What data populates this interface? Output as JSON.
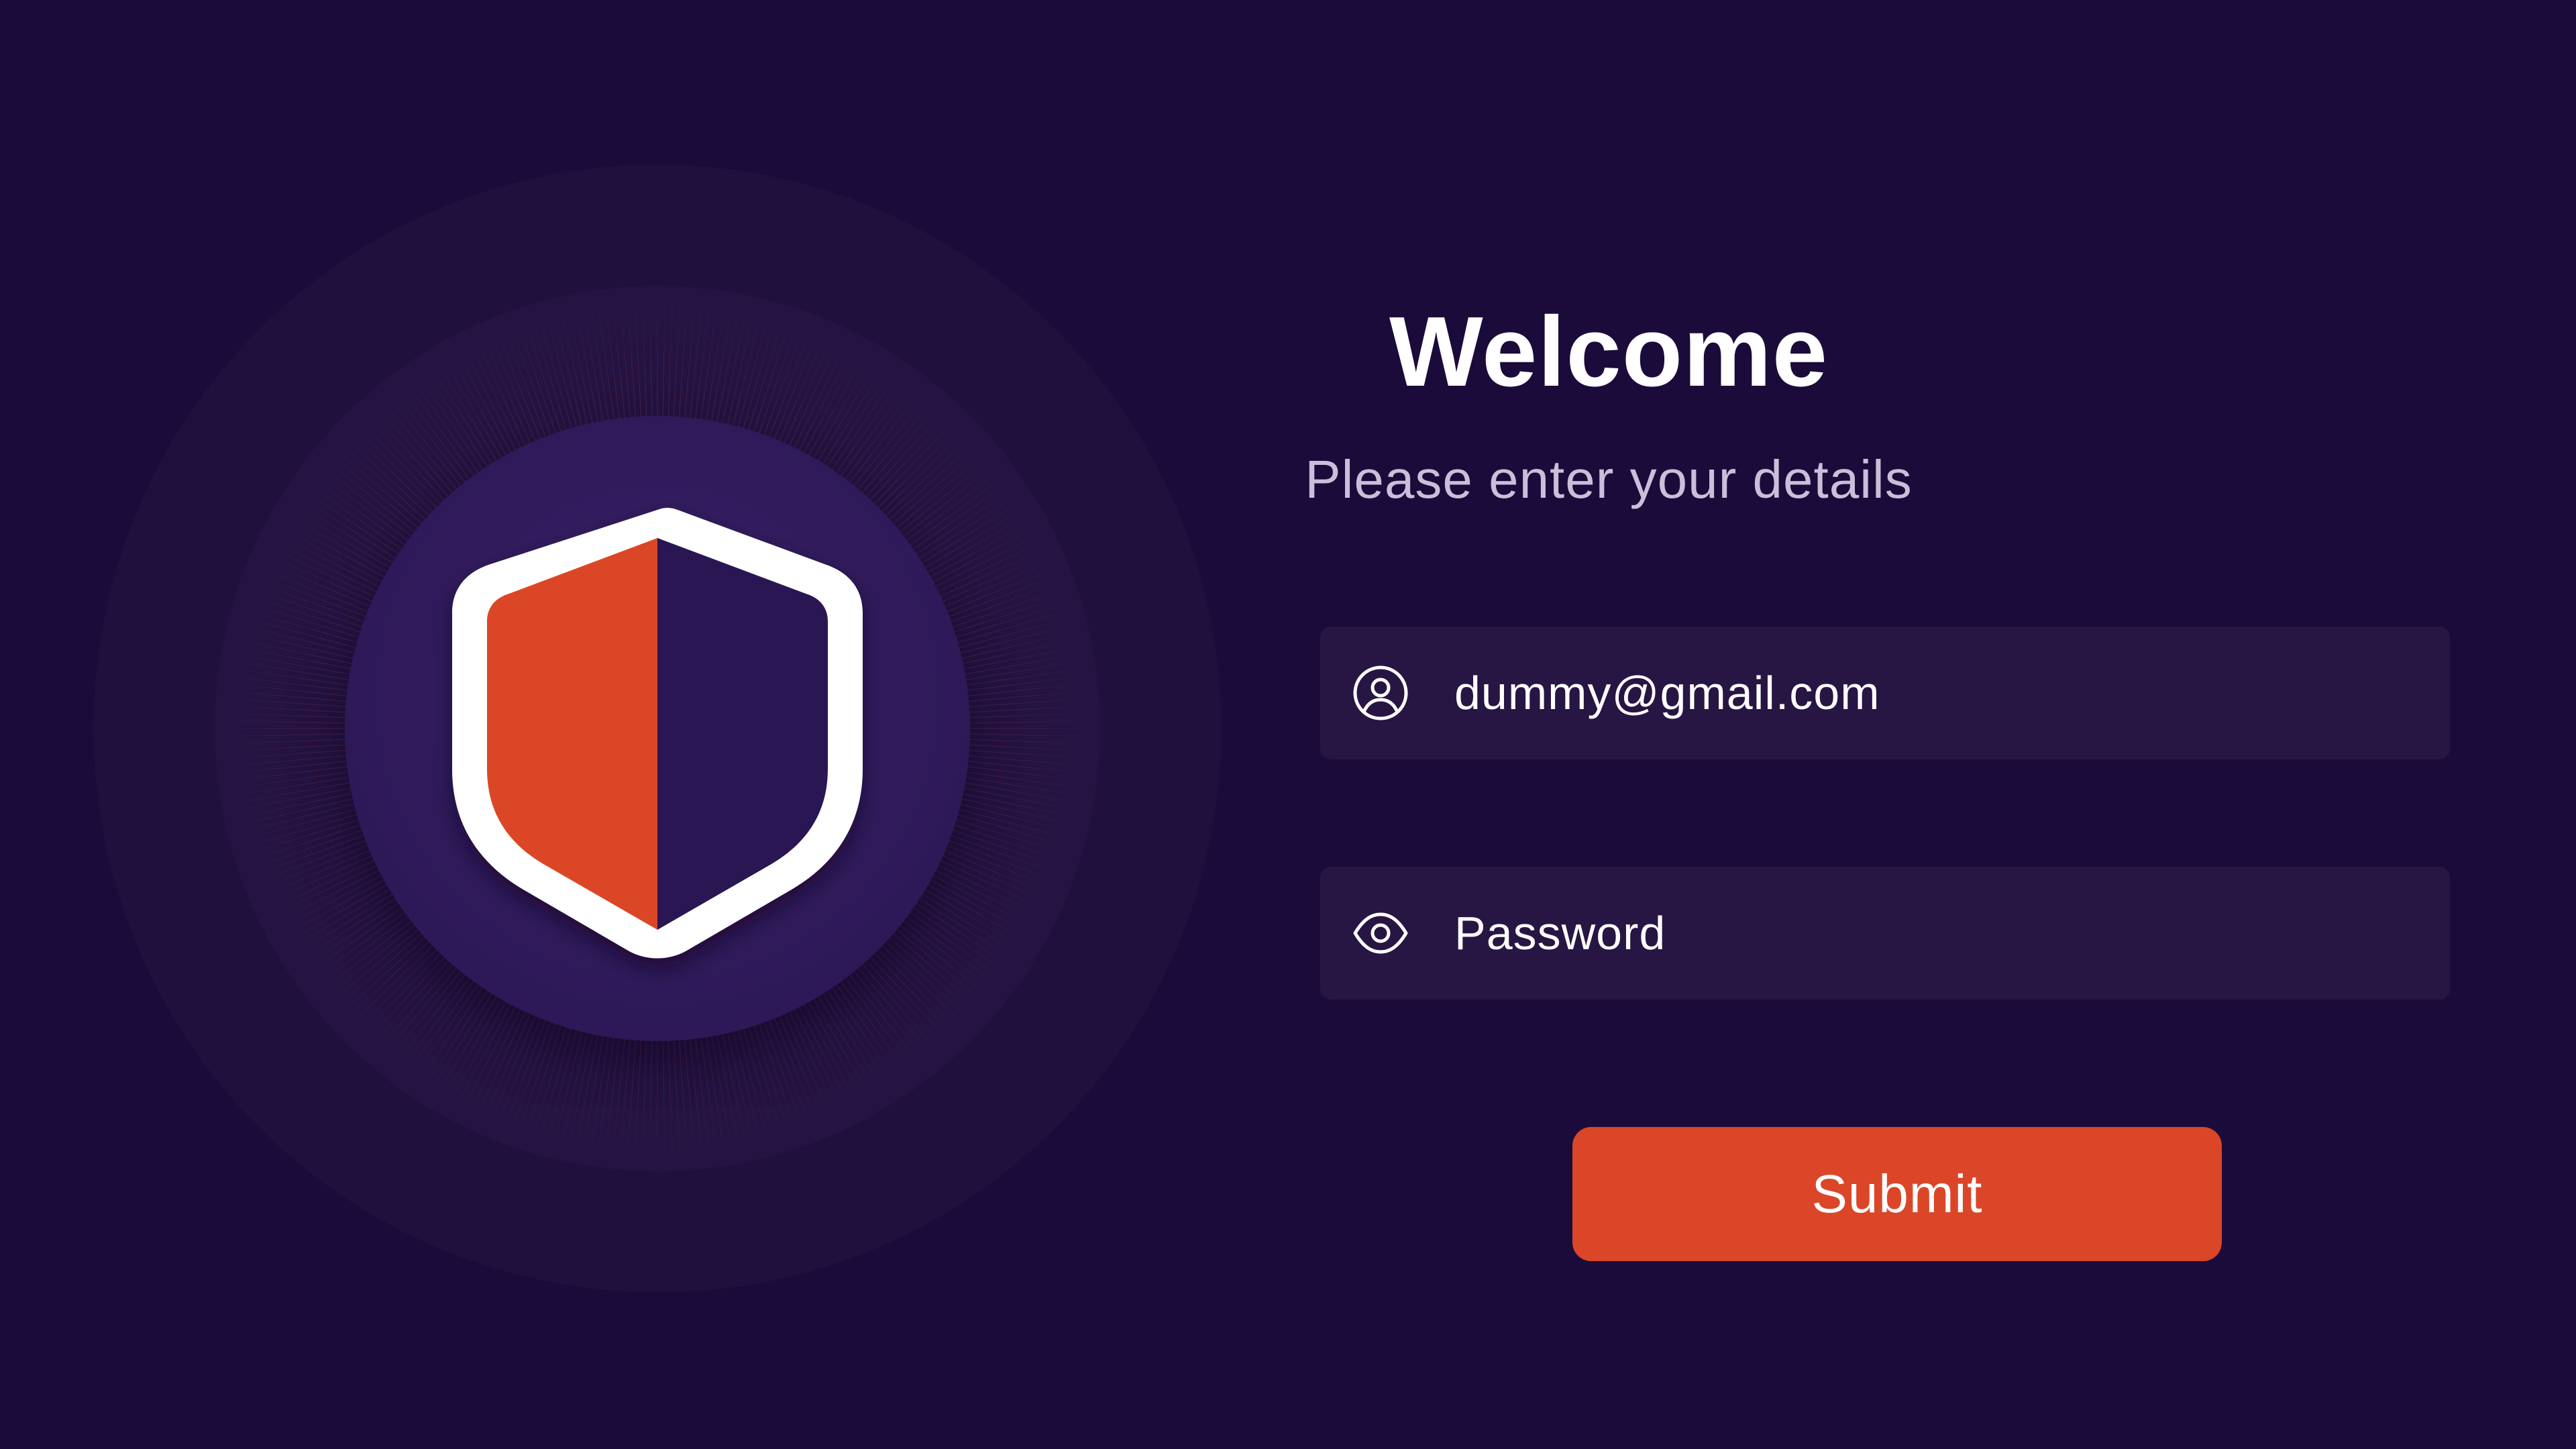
{
  "header": {
    "title": "Welcome",
    "subtitle": "Please enter your details"
  },
  "form": {
    "email": {
      "icon": "user-circle-icon",
      "value": "dummy@gmail.com"
    },
    "password": {
      "icon": "eye-icon",
      "placeholder": "Password"
    },
    "submit_label": "Submit"
  },
  "illustration": {
    "icon": "shield-icon"
  },
  "colors": {
    "background": "#1b0b3b",
    "field_background": "#271544",
    "accent": "#db4628",
    "shield_dark": "#2a1652",
    "subtitle_text": "#c9bfd9"
  }
}
